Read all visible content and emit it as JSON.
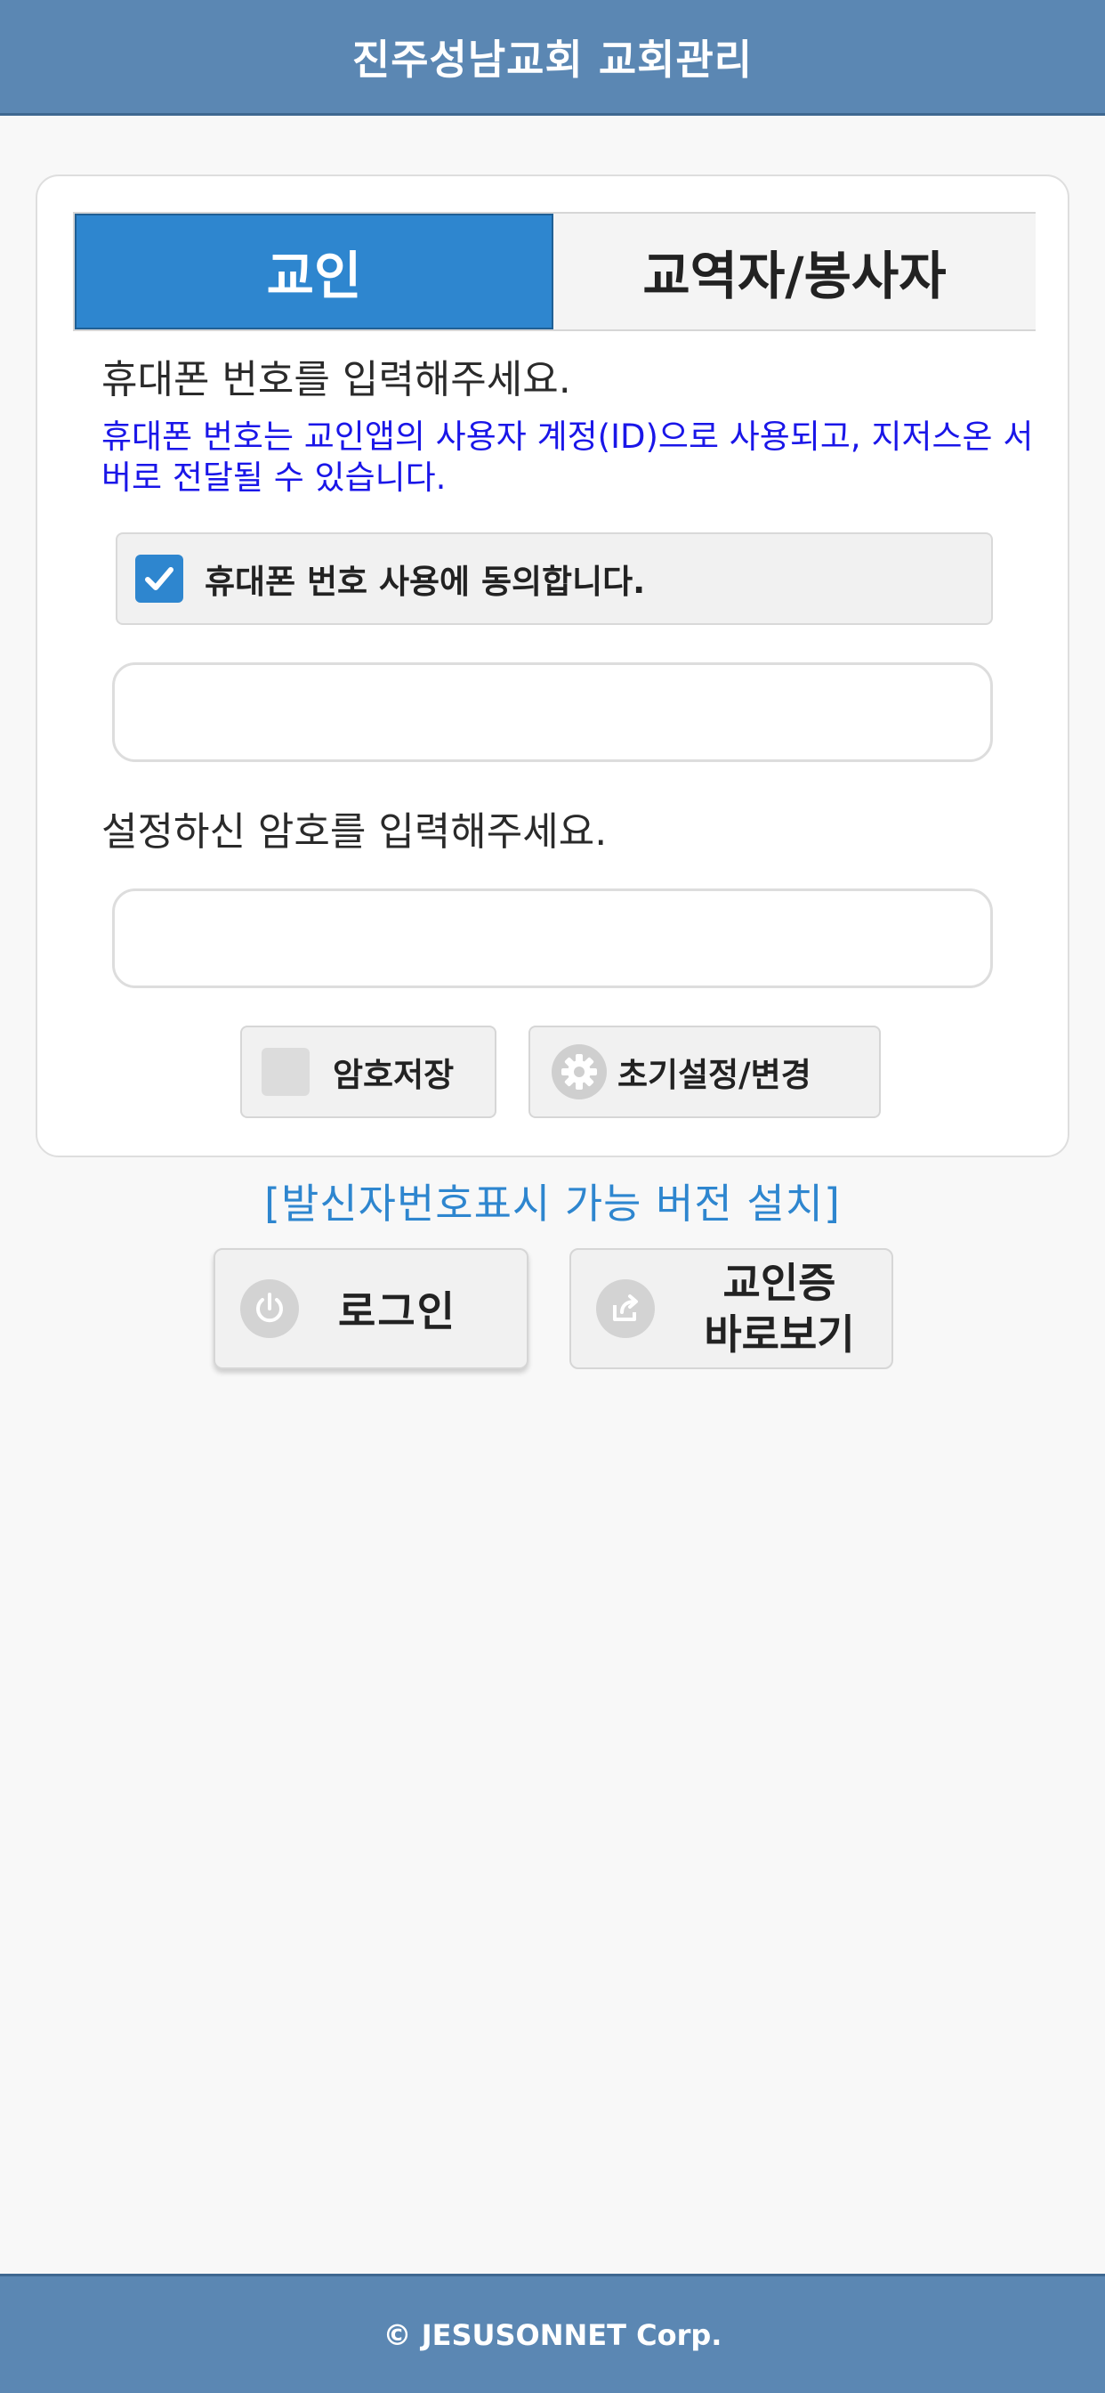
{
  "header": {
    "title": "진주성남교회 교회관리"
  },
  "tabs": [
    {
      "label": "교인",
      "active": true
    },
    {
      "label": "교역자/봉사자",
      "active": false
    }
  ],
  "phone": {
    "label": "휴대폰 번호를 입력해주세요.",
    "notice": "휴대폰 번호는 교인앱의 사용자 계정(ID)으로 사용되고, 지저스온 서버로 전달될 수 있습니다.",
    "agree_label": "휴대폰 번호 사용에 동의합니다.",
    "agree_checked": true,
    "value": "",
    "placeholder": ""
  },
  "password": {
    "label": "설정하신 암호를 입력해주세요.",
    "value": "",
    "placeholder": ""
  },
  "options": {
    "save_password_label": "암호저장",
    "save_password_checked": false,
    "reset_label": "초기설정/변경"
  },
  "caller_link": "[발신자번호표시 가능 버전 설치]",
  "actions": {
    "login_label": "로그인",
    "card_label": "교인증\n바로보기"
  },
  "footer": {
    "text": "© JESUSONNET Corp."
  },
  "colors": {
    "header_bg": "#5b87b3",
    "accent": "#2e86cf",
    "notice_text": "#1a16e8",
    "page_bg": "#f8f8f8"
  }
}
